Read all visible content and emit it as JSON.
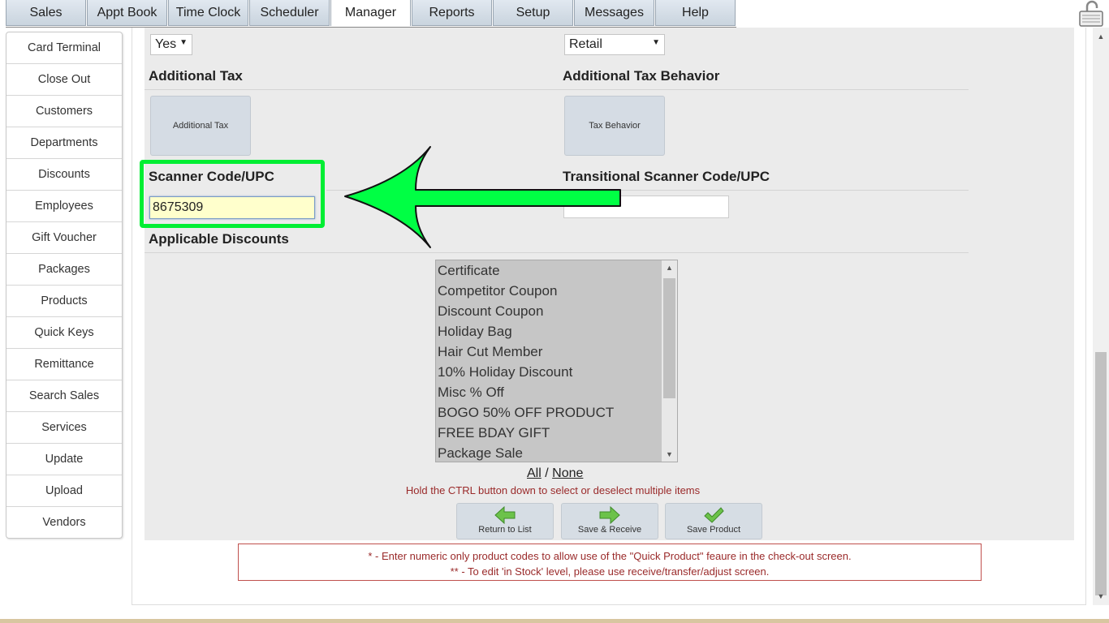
{
  "tabs": [
    "Sales",
    "Appt Book",
    "Time Clock",
    "Scheduler",
    "Manager",
    "Reports",
    "Setup",
    "Messages",
    "Help"
  ],
  "active_tab": "Manager",
  "sidebar": {
    "items": [
      "Card Terminal",
      "Close Out",
      "Customers",
      "Departments",
      "Discounts",
      "Employees",
      "Gift Voucher",
      "Packages",
      "Products",
      "Quick Keys",
      "Remittance",
      "Search Sales",
      "Services",
      "Update",
      "Upload",
      "Vendors"
    ]
  },
  "form": {
    "yes_select": "Yes",
    "retail_select": "Retail",
    "additional_tax_title": "Additional Tax",
    "additional_tax_button": "Additional Tax",
    "tax_behavior_title": "Additional Tax Behavior",
    "tax_behavior_button": "Tax Behavior",
    "scanner_title": "Scanner Code/UPC",
    "scanner_value": "8675309",
    "transitional_title": "Transitional Scanner Code/UPC",
    "transitional_value": "",
    "discounts_title": "Applicable Discounts",
    "discounts": [
      "Certificate",
      "Competitor Coupon",
      "Discount Coupon",
      "Holiday Bag",
      "Hair Cut Member",
      "10% Holiday Discount",
      "Misc % Off",
      "BOGO 50% OFF PRODUCT",
      "FREE BDAY GIFT",
      "Package Sale"
    ],
    "all_label": "All",
    "separator": "/",
    "none_label": "None",
    "ctrl_hint": "Hold the CTRL button down to select or deselect multiple items"
  },
  "actions": {
    "return_label": "Return to List",
    "save_receive_label": "Save & Receive",
    "save_label": "Save Product"
  },
  "notes": {
    "line1": "* - Enter numeric only product codes to allow use of the \"Quick Product\" feaure in the check-out screen.",
    "line2": "** - To edit 'in Stock' level, please use receive/transfer/adjust screen."
  },
  "colors": {
    "highlight": "#00ee33",
    "arrow_fill": "#00ff44",
    "note_text": "#9a2a2a"
  }
}
